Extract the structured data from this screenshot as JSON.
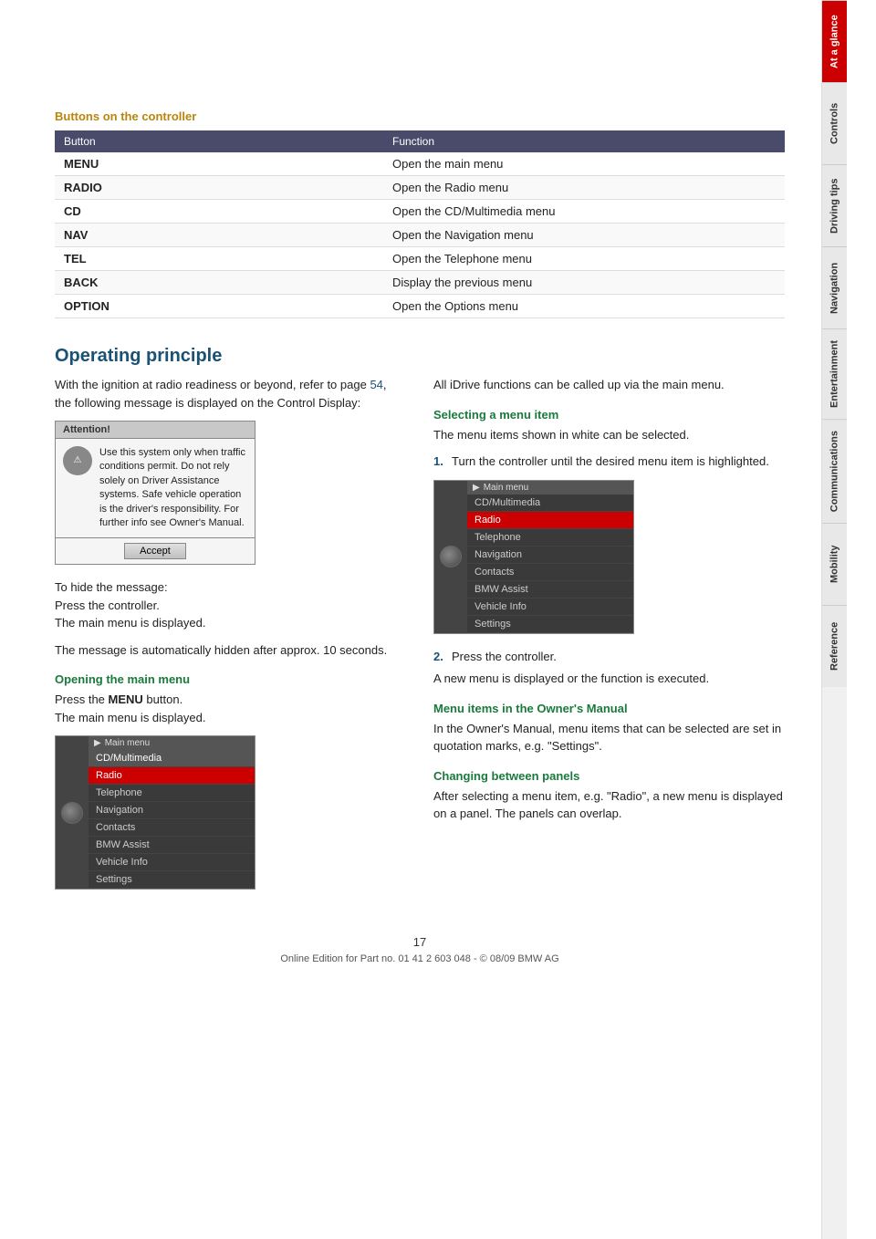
{
  "page": {
    "number": "17",
    "footer_text": "Online Edition for Part no. 01 41 2 603 048 - © 08/09 BMW AG"
  },
  "sidebar": {
    "tabs": [
      {
        "id": "at-a-glance",
        "label": "At a glance",
        "active": true
      },
      {
        "id": "controls",
        "label": "Controls",
        "active": false
      },
      {
        "id": "driving-tips",
        "label": "Driving tips",
        "active": false
      },
      {
        "id": "navigation",
        "label": "Navigation",
        "active": false
      },
      {
        "id": "entertainment",
        "label": "Entertainment",
        "active": false
      },
      {
        "id": "communications",
        "label": "Communications",
        "active": false
      },
      {
        "id": "mobility",
        "label": "Mobility",
        "active": false
      },
      {
        "id": "reference",
        "label": "Reference",
        "active": false
      }
    ]
  },
  "buttons_section": {
    "title": "Buttons on the controller",
    "table": {
      "headers": [
        "Button",
        "Function"
      ],
      "rows": [
        {
          "button": "MENU",
          "function": "Open the main menu"
        },
        {
          "button": "RADIO",
          "function": "Open the Radio menu"
        },
        {
          "button": "CD",
          "function": "Open the CD/Multimedia menu"
        },
        {
          "button": "NAV",
          "function": "Open the Navigation menu"
        },
        {
          "button": "TEL",
          "function": "Open the Telephone menu"
        },
        {
          "button": "BACK",
          "function": "Display the previous menu"
        },
        {
          "button": "OPTION",
          "function": "Open the Options menu"
        }
      ]
    }
  },
  "operating_principle": {
    "title": "Operating principle",
    "intro_text": "With the ignition at radio readiness or beyond, refer to page 54, the following message is displayed on the Control Display:",
    "attention_box": {
      "header": "Attention!",
      "text": "Use this system only when traffic conditions permit. Do not rely solely on Driver Assistance systems. Safe vehicle operation is the driver's responsibility. For further info see Owner's Manual.",
      "button": "Accept"
    },
    "hide_message_text": "To hide the message:\nPress the controller.\nThe main menu is displayed.",
    "auto_hide_text": "The message is automatically hidden after approx. 10 seconds.",
    "opening_main_menu": {
      "title": "Opening the main menu",
      "text_before": "Press the ",
      "bold_word": "MENU",
      "text_after": " button.\nThe main menu is displayed."
    },
    "main_menu_items": [
      "CD/Multimedia",
      "Radio",
      "Telephone",
      "Navigation",
      "Contacts",
      "BMW Assist",
      "Vehicle Info",
      "Settings"
    ],
    "main_menu_selected": "Radio",
    "right_column": {
      "intro": "All iDrive functions can be called up via the main menu.",
      "selecting_menu_item": {
        "title": "Selecting a menu item",
        "text": "The menu items shown in white can be selected.",
        "step1": "Turn the controller until the desired menu item is highlighted.",
        "step2": "Press the controller.",
        "after_step2": "A new menu is displayed or the function is executed."
      },
      "menu_items_manual": {
        "title": "Menu items in the Owner's Manual",
        "text": "In the Owner's Manual, menu items that can be selected are set in quotation marks, e.g. \"Settings\"."
      },
      "changing_panels": {
        "title": "Changing between panels",
        "text": "After selecting a menu item, e.g. \"Radio\", a new menu is displayed on a panel. The panels can overlap."
      }
    }
  }
}
